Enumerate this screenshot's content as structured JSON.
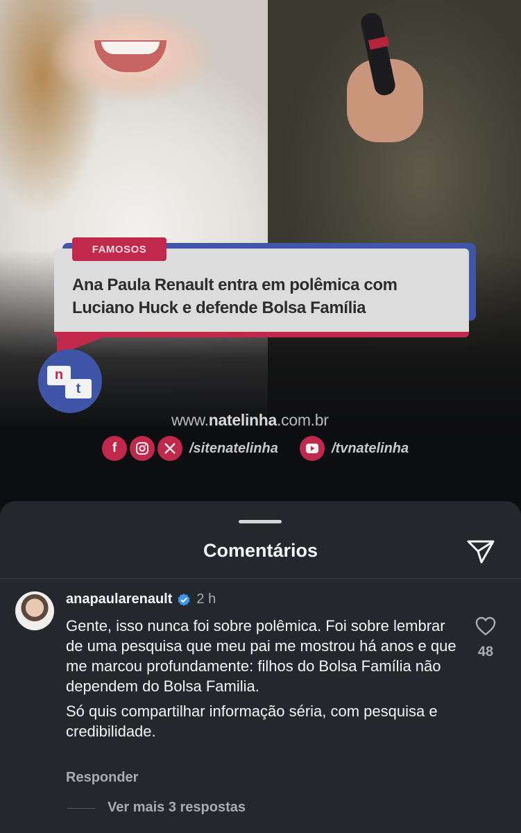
{
  "post": {
    "category": "FAMOSOS",
    "headline_line1": "Ana Paula Renault entra em polêmica com",
    "headline_line2": "Luciano Huck e defende Bolsa Família",
    "logo_n": "n",
    "logo_t": "t",
    "site_prefix": "www.",
    "site_brand": "natelinha",
    "site_suffix": ".com.br",
    "social_handle_1": "/sitenatelinha",
    "social_handle_2": "/tvnatelinha",
    "social_icons": [
      "facebook-icon",
      "instagram-icon",
      "x-icon",
      "youtube-icon"
    ]
  },
  "sheet": {
    "title": "Comentários"
  },
  "comment": {
    "username": "anapaularenault",
    "time": "2 h",
    "paragraph1": "Gente, isso nunca foi sobre polêmica. Foi sobre lembrar de uma pesquisa que meu pai me mostrou há anos e que me marcou profundamente: filhos do Bolsa Família não dependem do Bolsa Familia.",
    "paragraph2": "Só quis compartilhar informação séria, com pesquisa e credibilidade.",
    "likes": "48",
    "reply_label": "Responder",
    "more_replies": "Ver mais 3 respostas"
  },
  "colors": {
    "brand_red": "#c0294c",
    "brand_blue": "#3f55a8",
    "sheet_bg": "#24272b",
    "verified_blue": "#3897f0"
  }
}
